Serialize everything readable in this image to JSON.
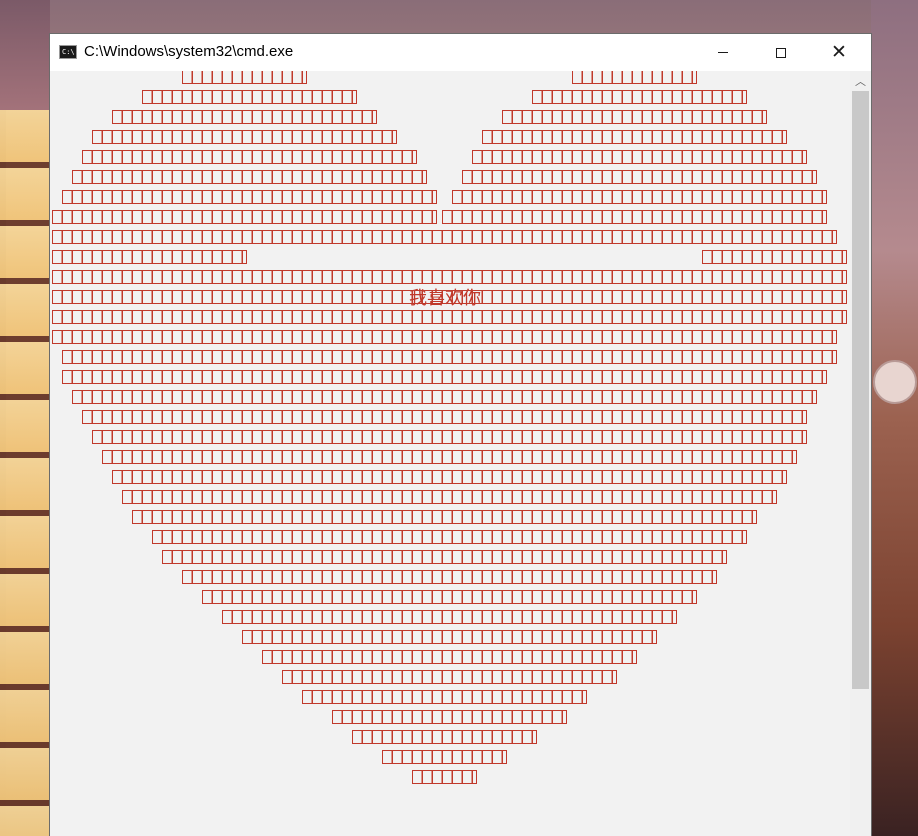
{
  "window": {
    "title": "C:\\Windows\\system32\\cmd.exe",
    "icon": "cmd-icon",
    "controls": [
      "minimize",
      "maximize",
      "close"
    ]
  },
  "console": {
    "message": "我喜欢你",
    "text_color": "#c0392b",
    "background": "#f2f2f2"
  },
  "colors": {
    "accent": "#c0392b",
    "titlebar": "#ffffff"
  }
}
